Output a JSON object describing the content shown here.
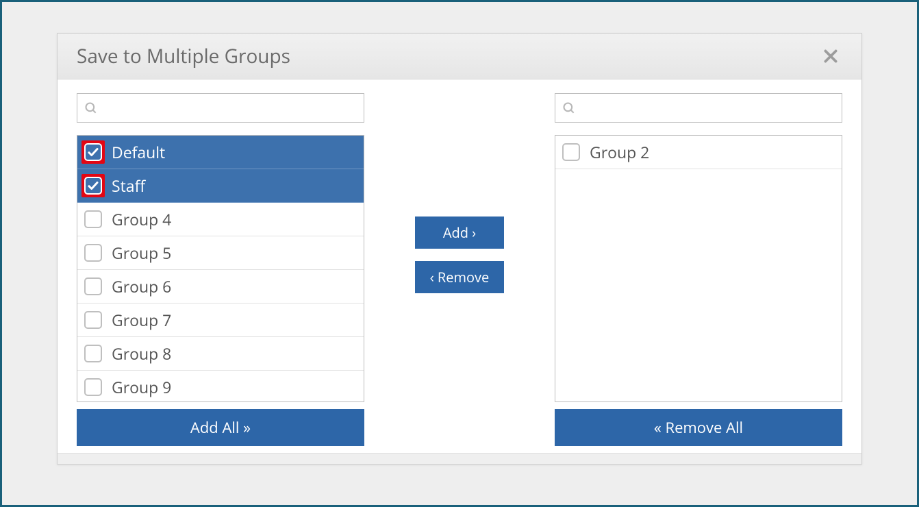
{
  "dialog": {
    "title": "Save to Multiple Groups"
  },
  "left": {
    "search_placeholder": "",
    "items": [
      {
        "label": "Default",
        "selected": true,
        "highlighted": true
      },
      {
        "label": "Staff",
        "selected": true,
        "highlighted": true
      },
      {
        "label": "Group 4",
        "selected": false,
        "highlighted": false
      },
      {
        "label": "Group 5",
        "selected": false,
        "highlighted": false
      },
      {
        "label": "Group 6",
        "selected": false,
        "highlighted": false
      },
      {
        "label": "Group 7",
        "selected": false,
        "highlighted": false
      },
      {
        "label": "Group 8",
        "selected": false,
        "highlighted": false
      },
      {
        "label": "Group 9",
        "selected": false,
        "highlighted": false
      }
    ],
    "add_all_label": "Add All »"
  },
  "right": {
    "search_placeholder": "",
    "items": [
      {
        "label": "Group 2",
        "selected": false,
        "highlighted": false
      }
    ],
    "remove_all_label": "« Remove All"
  },
  "middle": {
    "add_label": "Add ›",
    "remove_label": "‹ Remove"
  }
}
